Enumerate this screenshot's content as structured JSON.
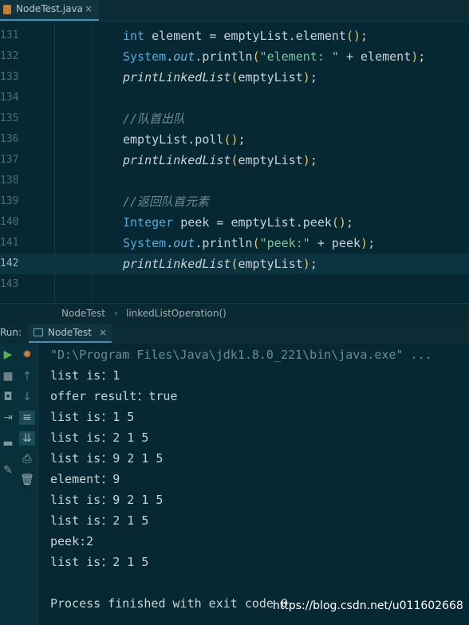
{
  "tab": {
    "filename": "NodeTest.java",
    "close": "×"
  },
  "editor": {
    "lines": [
      {
        "num": "131",
        "segments": [
          [
            "kw",
            "int"
          ],
          [
            "p",
            " element = emptyList.element"
          ],
          [
            "par",
            "()"
          ],
          [
            "p",
            ";"
          ]
        ]
      },
      {
        "num": "132",
        "segments": [
          [
            "kw",
            "System"
          ],
          [
            "p",
            "."
          ],
          [
            "fld",
            "out"
          ],
          [
            "p",
            ".println"
          ],
          [
            "par",
            "("
          ],
          [
            "str",
            "\"element: \""
          ],
          [
            "p",
            " + element"
          ],
          [
            "par",
            ")"
          ],
          [
            "p",
            ";"
          ]
        ]
      },
      {
        "num": "133",
        "segments": [
          [
            "it",
            "printLinkedList"
          ],
          [
            "par",
            "("
          ],
          [
            "p",
            "emptyList"
          ],
          [
            "par",
            ")"
          ],
          [
            "p",
            ";"
          ]
        ]
      },
      {
        "num": "134",
        "segments": []
      },
      {
        "num": "135",
        "segments": [
          [
            "cm",
            "//队首出队"
          ]
        ]
      },
      {
        "num": "136",
        "segments": [
          [
            "p",
            "emptyList.poll"
          ],
          [
            "par",
            "()"
          ],
          [
            "p",
            ";"
          ]
        ]
      },
      {
        "num": "137",
        "segments": [
          [
            "it",
            "printLinkedList"
          ],
          [
            "par",
            "("
          ],
          [
            "p",
            "emptyList"
          ],
          [
            "par",
            ")"
          ],
          [
            "p",
            ";"
          ]
        ]
      },
      {
        "num": "138",
        "segments": []
      },
      {
        "num": "139",
        "segments": [
          [
            "cm",
            "//返回队首元素"
          ]
        ]
      },
      {
        "num": "140",
        "segments": [
          [
            "kw",
            "Integer"
          ],
          [
            "p",
            " peek = emptyList.peek"
          ],
          [
            "par",
            "()"
          ],
          [
            "p",
            ";"
          ]
        ]
      },
      {
        "num": "141",
        "segments": [
          [
            "kw",
            "System"
          ],
          [
            "p",
            "."
          ],
          [
            "fld",
            "out"
          ],
          [
            "p",
            ".println"
          ],
          [
            "par",
            "("
          ],
          [
            "str",
            "\"peek:\""
          ],
          [
            "p",
            " + peek"
          ],
          [
            "par",
            ")"
          ],
          [
            "p",
            ";"
          ]
        ]
      },
      {
        "num": "142",
        "segments": [
          [
            "it",
            "printLinkedList"
          ],
          [
            "par",
            "("
          ],
          [
            "p",
            "emptyList"
          ],
          [
            "par",
            ")"
          ],
          [
            "p",
            ";"
          ]
        ]
      },
      {
        "num": "143",
        "segments": []
      }
    ],
    "active_line": "142"
  },
  "breadcrumb": {
    "class_name": "NodeTest",
    "separator": "›",
    "method": "linkedListOperation()"
  },
  "run_panel": {
    "label": "Run:",
    "tab_label": "NodeTest",
    "tab_close": "×"
  },
  "console": {
    "lines": [
      "\"D:\\Program Files\\Java\\jdk1.8.0_221\\bin\\java.exe\" ...",
      "list is：1",
      "offer result：true",
      "list is：1 5",
      "list is：2 1 5",
      "list is：9 2 1 5",
      "element：9",
      "list is：9 2 1 5",
      "list is：2 1 5",
      "peek:2",
      "list is：2 1 5",
      "",
      "Process finished with exit code 0"
    ]
  },
  "watermark": "https://blog.csdn.net/u011602668",
  "colors": {
    "background": "#062832",
    "keyword": "#55a8e0",
    "string": "#7ec699",
    "comment": "#6d8a94",
    "paren": "#e8c36a"
  }
}
